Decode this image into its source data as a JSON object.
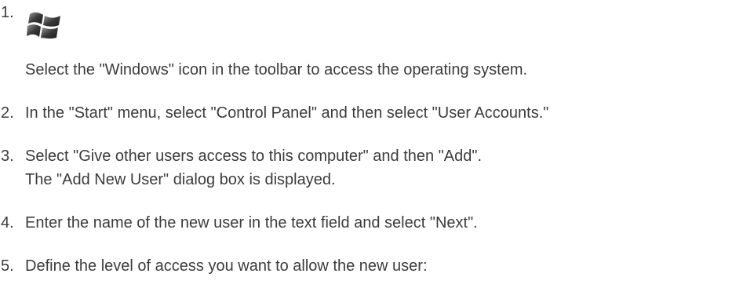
{
  "steps": [
    {
      "number": "1.",
      "text": "Select the \"Windows\" icon in the toolbar to access the operating system.",
      "icon": "windows-logo-icon"
    },
    {
      "number": "2.",
      "text": "In the \"Start\" menu, select \"Control Panel\" and then select \"User Accounts.\""
    },
    {
      "number": "3.",
      "text": "Select \"Give other users access to this computer\" and then \"Add\".",
      "text2": "The \"Add New User\" dialog box is displayed."
    },
    {
      "number": "4.",
      "text": "Enter the name of the new user in the text field and select \"Next\"."
    },
    {
      "number": "5.",
      "text": "Define the level of access you want to allow the new user:"
    }
  ]
}
